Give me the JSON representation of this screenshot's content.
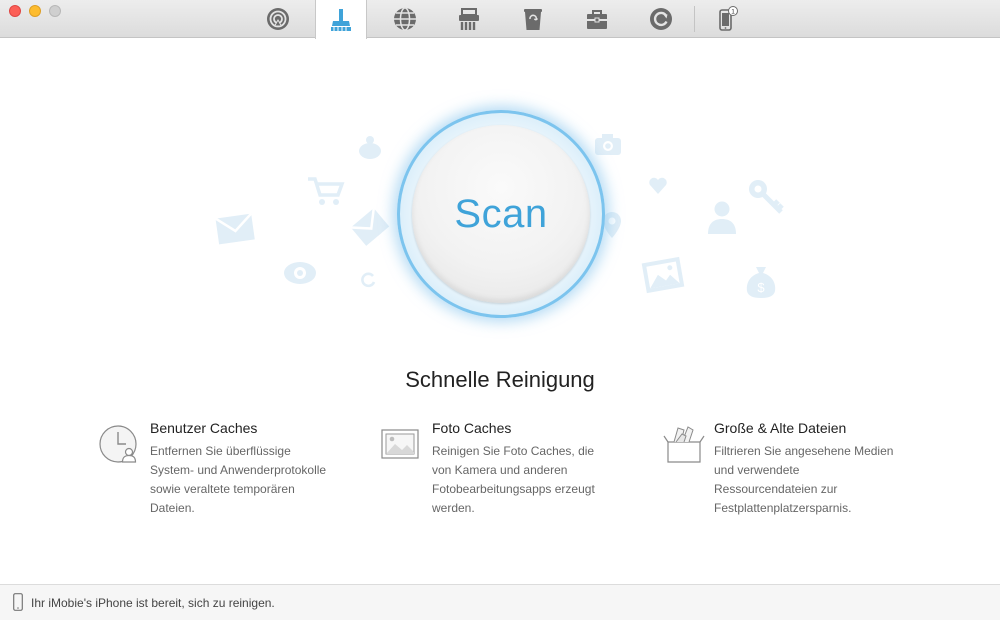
{
  "toolbar": {
    "items": [
      {
        "icon": "airplay-icon",
        "active": false
      },
      {
        "icon": "cleaner-brush-icon",
        "active": true
      },
      {
        "icon": "globe-icon",
        "active": false
      },
      {
        "icon": "shredder-icon",
        "active": false
      },
      {
        "icon": "trash-icon",
        "active": false
      },
      {
        "icon": "toolbox-icon",
        "active": false
      },
      {
        "icon": "refresh-icon",
        "active": false
      },
      {
        "icon": "iphone-icon",
        "active": false
      }
    ],
    "device_badge": "1",
    "accent_color": "#3fa3d9"
  },
  "scan": {
    "label": "Scan"
  },
  "main": {
    "title": "Schnelle Reinigung",
    "features": [
      {
        "icon": "clock-user-icon",
        "title": "Benutzer Caches",
        "desc_lines": [
          "Entfernen Sie überflüssige",
          "System- und Anwenderprotokolle",
          "sowie veraltete temporären",
          "Dateien."
        ]
      },
      {
        "icon": "photo-icon",
        "title": "Foto Caches",
        "desc_lines": [
          "Reinigen Sie Foto Caches, die",
          "von Kamera und anderen",
          "Fotobearbeitungsapps erzeugt",
          "werden."
        ]
      },
      {
        "icon": "box-icon",
        "title": "Große & Alte Dateien",
        "desc_lines": [
          "Filtrieren Sie angesehene Medien",
          "und verwendete",
          "Ressourcendateien zur",
          "Festplattenplatzersparnis."
        ]
      }
    ]
  },
  "status": {
    "icon": "phone-icon",
    "text": "Ihr iMobie's iPhone ist bereit, sich zu reinigen."
  }
}
